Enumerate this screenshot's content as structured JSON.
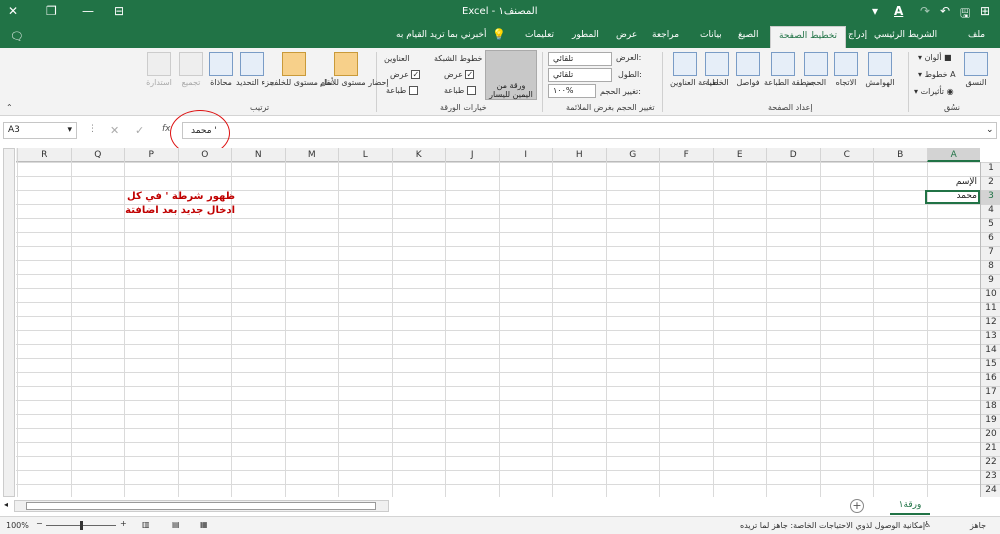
{
  "titlebar": {
    "title": "Excel - المصنف١",
    "share_icon": "share-icon",
    "font_icon": "font-color-icon"
  },
  "tabs": {
    "items": [
      {
        "label": "ملف"
      },
      {
        "label": "الشريط الرئيسي"
      },
      {
        "label": "إدراج"
      },
      {
        "label": "تخطيط الصفحة",
        "active": true
      },
      {
        "label": "الصيغ"
      },
      {
        "label": "بيانات"
      },
      {
        "label": "مراجعة"
      },
      {
        "label": "عرض"
      },
      {
        "label": "المطور"
      },
      {
        "label": "تعليمات"
      },
      {
        "label": "أخبرني بما تريد القيام به"
      }
    ]
  },
  "ribbon": {
    "themes": {
      "title": "نسُق",
      "themes_btn": "النسق",
      "colors": "ألوان",
      "fonts": "خطوط",
      "effects": "تأثيرات"
    },
    "page_setup": {
      "title": "إعداد الصفحة",
      "margins": "الهوامش",
      "orientation": "الاتجاه",
      "size": "الحجم",
      "print_area": "منطقة الطباعة",
      "breaks": "فواصل",
      "background": "الخلفية",
      "print_titles": "طباعة العناوين"
    },
    "scale": {
      "title": "تغيير الحجم بغرض الملائمة",
      "width_label": "العرض:",
      "width_value": "تلقائي",
      "height_label": "الطول:",
      "height_value": "تلقائي",
      "scale_label": "تغيير الحجم:",
      "scale_value": "١٠٠%"
    },
    "sheet_options": {
      "title": "خيارات الورقة",
      "gridlines": "خطوط الشبكة",
      "headings": "العناوين",
      "view": "عرض",
      "print": "طباعة",
      "rtl_btn": "ورقة من اليمين لليسار"
    },
    "arrange": {
      "title": "ترتيب",
      "bring_forward": "إحضار مستوى للأمام",
      "send_backward": "نقل مستوى للخلف",
      "selection_pane": "جزء التحديد",
      "align": "محاذاة",
      "group": "تجميع",
      "rotate": "استدارة"
    }
  },
  "formula_bar": {
    "name_box": "A3",
    "content": "محمد '",
    "fx": "fx"
  },
  "grid": {
    "columns": [
      "A",
      "B",
      "C",
      "D",
      "E",
      "F",
      "G",
      "H",
      "I",
      "J",
      "K",
      "L",
      "M",
      "N",
      "O",
      "P",
      "Q",
      "R"
    ],
    "rows": [
      "1",
      "2",
      "3",
      "4",
      "5",
      "6",
      "7",
      "8",
      "9",
      "10",
      "11",
      "12",
      "13",
      "14",
      "15",
      "16",
      "17",
      "18",
      "19",
      "20",
      "21",
      "22",
      "23",
      "24"
    ],
    "cells": {
      "A2": "الإسم",
      "A3": "محمد"
    },
    "selected": "A3"
  },
  "annotation": {
    "line1": "ظهور شرطة ' في كل",
    "line2": "ادخال جديد بعد اضافتة"
  },
  "sheet_tab": "ورقة١",
  "status": {
    "ready": "جاهز",
    "accessibility": "إمكانية الوصول لذوي الاحتياجات الخاصة: جاهز لما تريده",
    "zoom": "100%"
  }
}
